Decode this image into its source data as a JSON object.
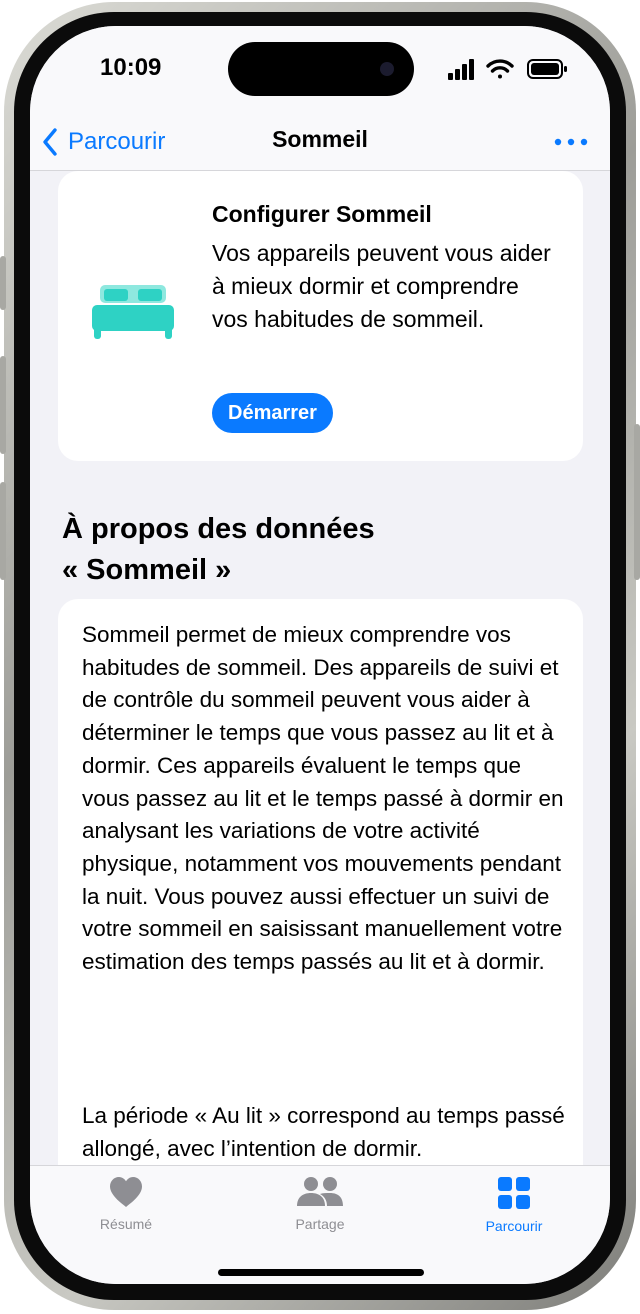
{
  "status": {
    "time": "10:09"
  },
  "nav": {
    "back_label": "Parcourir",
    "title": "Sommeil"
  },
  "setup_card": {
    "title": "Configurer Sommeil",
    "description": "Vos appareils peuvent vous aider à mieux dormir et comprendre vos habitudes de sommeil.",
    "button_label": "Démarrer"
  },
  "about": {
    "title_line1": "À propos des données",
    "title_line2": "« Sommeil »",
    "paragraph1": "Sommeil permet de mieux comprendre vos habitudes de sommeil. Des appareils de suivi et de contrôle du sommeil peuvent vous aider à déterminer le temps que vous passez au lit et à dormir. Ces appareils évaluent le temps que vous passez au lit et le temps passé à dormir en analysant les variations de votre activité physique, notamment vos mouvements pendant la nuit. Vous pouvez aussi effectuer un suivi de votre sommeil en saisissant manuellement votre estimation des temps passés au lit et à dormir.",
    "paragraph2": "La période « Au lit » correspond au temps passé allongé, avec l’intention de dormir."
  },
  "tabs": [
    {
      "label": "Résumé",
      "icon": "heart-icon",
      "active": false
    },
    {
      "label": "Partage",
      "icon": "people-icon",
      "active": false
    },
    {
      "label": "Parcourir",
      "icon": "grid-icon",
      "active": true
    }
  ],
  "colors": {
    "accent": "#0a7aff",
    "bed_icon": "#2ed2c4",
    "tab_inactive": "#8e8e93",
    "background": "#f2f2f7"
  }
}
